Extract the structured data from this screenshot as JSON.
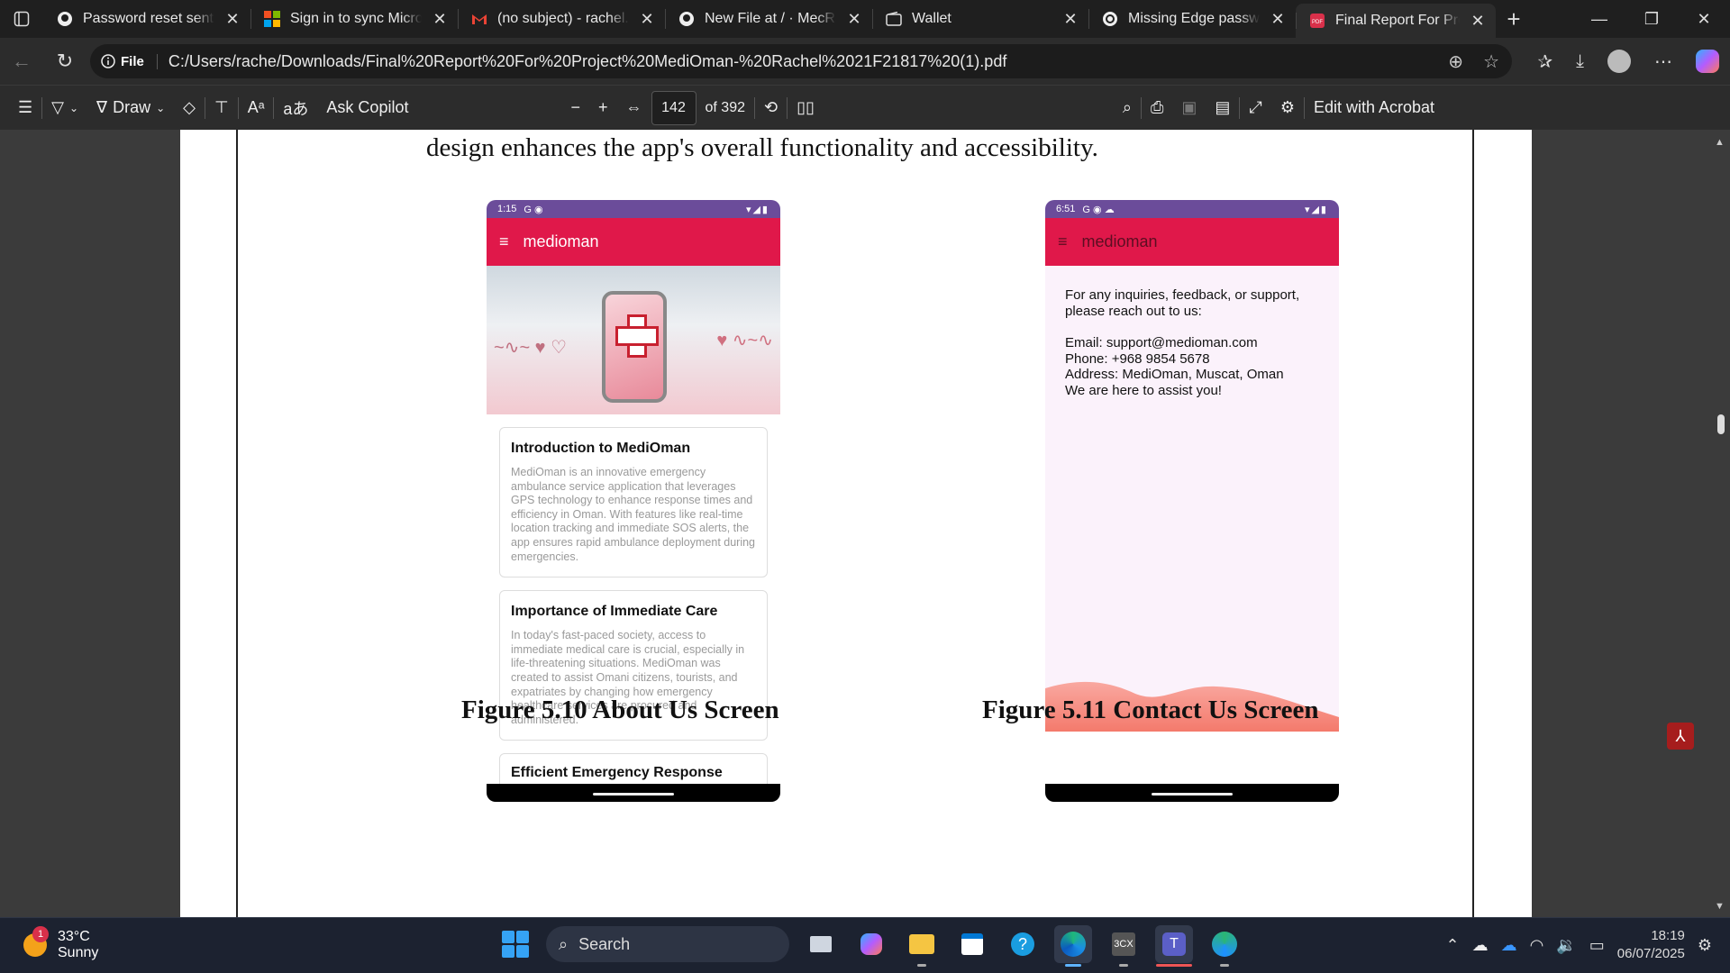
{
  "tabs": [
    {
      "title": "Password reset sent! · G",
      "icon": "github-icon"
    },
    {
      "title": "Sign in to sync Microsoft",
      "icon": "microsoft-icon"
    },
    {
      "title": "(no subject) - rachel.ds",
      "icon": "gmail-icon"
    },
    {
      "title": "New File at / · MecRach",
      "icon": "github-icon"
    },
    {
      "title": "Wallet",
      "icon": "wallet-icon"
    },
    {
      "title": "Missing Edge password",
      "icon": "chatgpt-icon"
    },
    {
      "title": "Final Report For Project",
      "icon": "pdf-icon"
    }
  ],
  "address": {
    "scheme_label": "File",
    "url": "C:/Users/rache/Downloads/Final%20Report%20For%20Project%20MediOman-%20Rachel%2021F21817%20(1).pdf"
  },
  "pdf_toolbar": {
    "draw_label": "Draw",
    "copilot_label": "Ask Copilot",
    "page_current": "142",
    "page_total": "of 392",
    "acrobat_label": "Edit with Acrobat"
  },
  "document": {
    "top_line": "design enhances the app's overall functionality and accessibility.",
    "caption_left": "Figure 5.10 About Us Screen",
    "caption_right": "Figure 5.11 Contact Us Screen"
  },
  "about_screen": {
    "time": "1:15",
    "status_glyphs": "G ◉",
    "app_title": "medioman",
    "cards": [
      {
        "title": "Introduction to MediOman",
        "body": "MediOman is an innovative emergency ambulance service application that leverages GPS technology to enhance response times and efficiency in Oman. With features like real-time location tracking and immediate SOS alerts, the app ensures rapid ambulance deployment during emergencies."
      },
      {
        "title": "Importance of Immediate Care",
        "body": "In today's fast-paced society, access to immediate medical care is crucial, especially in life-threatening situations. MediOman was created to assist Omani citizens, tourists, and expatriates by changing how emergency healthcare services are procured and administered."
      },
      {
        "title": "Efficient Emergency Response",
        "body": ""
      }
    ]
  },
  "contact_screen": {
    "time": "6:51",
    "status_glyphs": "G ◉ ☁",
    "app_title": "medioman",
    "intro": "For any inquiries, feedback, or support, please reach out to us:",
    "email": "Email: support@medioman.com",
    "phone": "Phone: +968 9854 5678",
    "address": "Address: MediOman, Muscat, Oman",
    "closing": "We are here to assist you!"
  },
  "taskbar": {
    "temperature": "33°C",
    "condition": "Sunny",
    "weather_badge": "1",
    "search_label": "Search",
    "time": "18:19",
    "date": "06/07/2025"
  },
  "colors": {
    "app_red": "#e0184a",
    "status_purple": "#6b4c9a",
    "edge_dark": "#1f1f1f"
  }
}
